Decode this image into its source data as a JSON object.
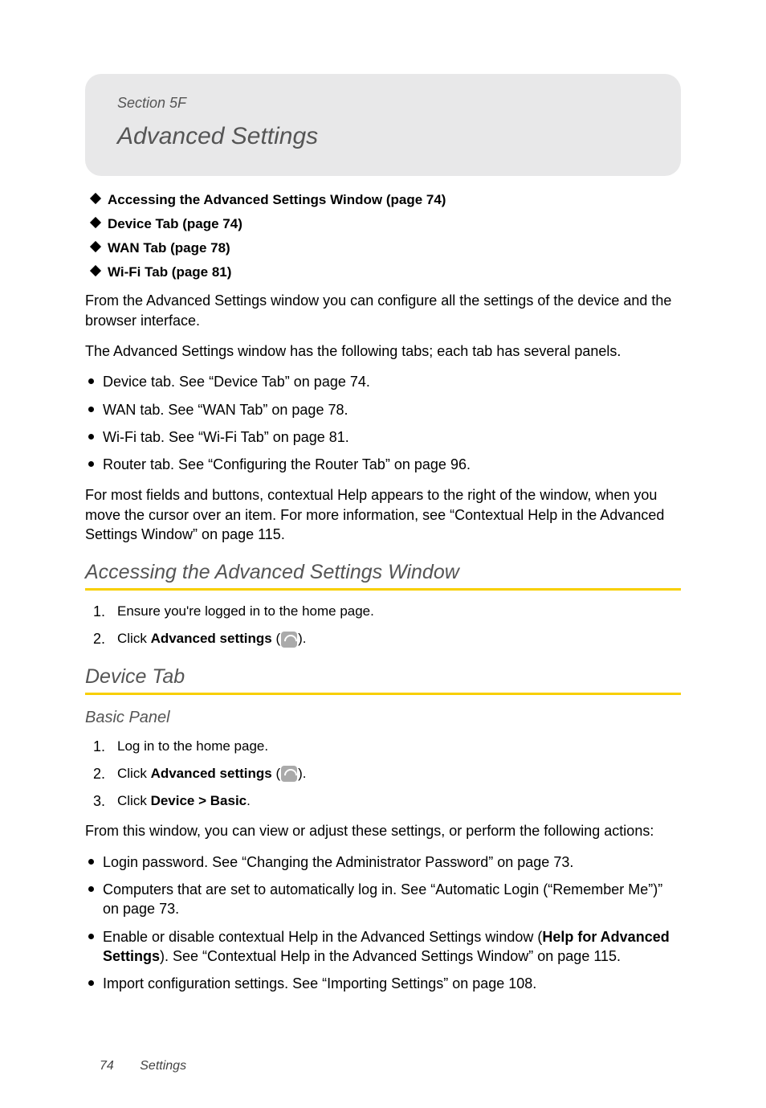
{
  "header": {
    "section_label": "Section 5F",
    "title": "Advanced Settings"
  },
  "toc": [
    "Accessing the Advanced Settings Window (page 74)",
    "Device Tab (page 74)",
    "WAN Tab (page 78)",
    "Wi-Fi Tab (page 81)"
  ],
  "intro1": "From the Advanced Settings window you can configure all the settings of the device and the browser interface.",
  "intro2": "The Advanced Settings window has the following tabs; each tab has several panels.",
  "tabs_list": [
    "Device tab. See “Device Tab” on page 74.",
    "WAN tab. See “WAN Tab” on page 78.",
    "Wi-Fi tab. See “Wi-Fi Tab” on page 81.",
    "Router tab. See “Configuring the Router Tab” on page 96."
  ],
  "intro3": "For most fields and buttons, contextual Help appears to the right of the window, when you move the cursor over an item. For more information, see “Contextual Help in the Advanced Settings Window” on page 115.",
  "h2_access": "Accessing the Advanced Settings Window",
  "steps_access": {
    "s1": "Ensure you're logged in to the home page.",
    "s2a": "Click ",
    "s2b": "Advanced settings",
    "s2c": " (",
    "s2d": ")."
  },
  "h2_device": "Device Tab",
  "h3_basic": "Basic Panel",
  "steps_basic": {
    "s1": "Log in to the home page.",
    "s2a": "Click ",
    "s2b": "Advanced settings",
    "s2c": " (",
    "s2d": ").",
    "s3a": "Click ",
    "s3b": "Device > Basic",
    "s3c": "."
  },
  "basic_intro": "From this window, you can view or adjust these settings, or perform the following actions:",
  "basic_bullets": {
    "b1": "Login password. See “Changing the Administrator Password” on page 73.",
    "b2": "Computers that are set to automatically log in. See “Automatic Login (“Remember Me”)” on page 73.",
    "b3a": "Enable or disable contextual Help in the Advanced Settings window (",
    "b3b": "Help for Advanced Settings",
    "b3c": "). See “Contextual Help in the Advanced Settings Window” on page 115.",
    "b4": "Import configuration settings. See “Importing Settings” on page 108."
  },
  "footer": {
    "page_num": "74",
    "chapter": "Settings"
  }
}
